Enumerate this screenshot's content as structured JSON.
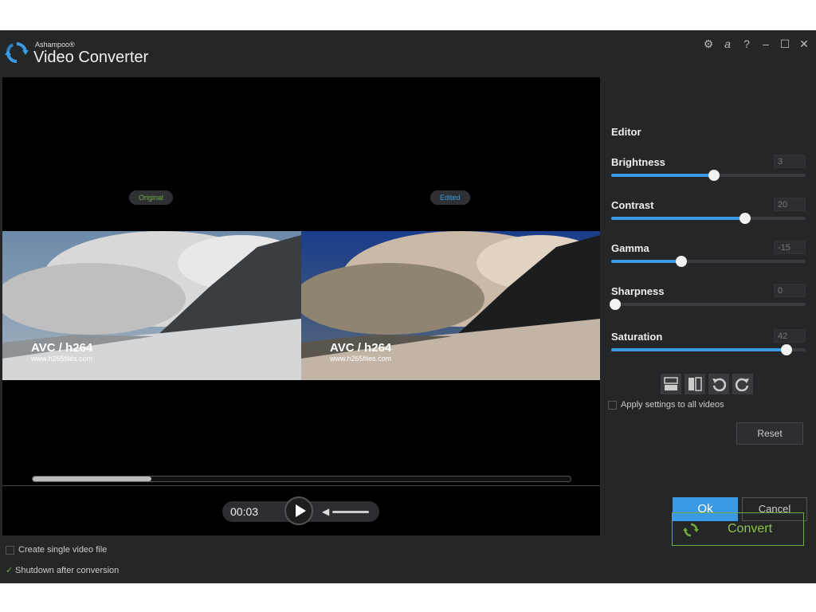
{
  "app": {
    "brand_small": "Ashampoo®",
    "brand_big": "Video Converter"
  },
  "window_controls": [
    "gear-icon",
    "ashampoo-a-icon",
    "help-icon",
    "minimize-icon",
    "maximize-icon",
    "close-icon"
  ],
  "preview": {
    "original_label": "Original",
    "edited_label": "Edited",
    "watermark_title": "AVC / h264",
    "watermark_url": "www.h265files.com",
    "progress_fraction": 0.22,
    "time": "00:03",
    "volume_fraction": 1.0
  },
  "editor": {
    "title": "Editor",
    "sliders": [
      {
        "label": "Brightness",
        "value": "3",
        "position": 0.53
      },
      {
        "label": "Contrast",
        "value": "20",
        "position": 0.69
      },
      {
        "label": "Gamma",
        "value": "-15",
        "position": 0.36
      },
      {
        "label": "Sharpness",
        "value": "0",
        "position": 0.02
      },
      {
        "label": "Saturation",
        "value": "42",
        "position": 0.9
      }
    ],
    "tool_icons": [
      "split-horizontal-icon",
      "split-vertical-icon",
      "rotate-left-icon",
      "rotate-right-icon"
    ],
    "apply_label": "Apply settings to all videos",
    "apply_checked": false,
    "reset_label": "Reset",
    "ok_label": "Ok",
    "cancel_label": "Cancel"
  },
  "footer": {
    "single_file_label": "Create single video file",
    "single_file_checked": false,
    "shutdown_label": "Shutdown after conversion",
    "shutdown_checked": true,
    "convert_label": "Convert"
  },
  "colors": {
    "accent_blue": "#3a9ae4",
    "accent_green": "#6fae3e",
    "background": "#252628"
  }
}
